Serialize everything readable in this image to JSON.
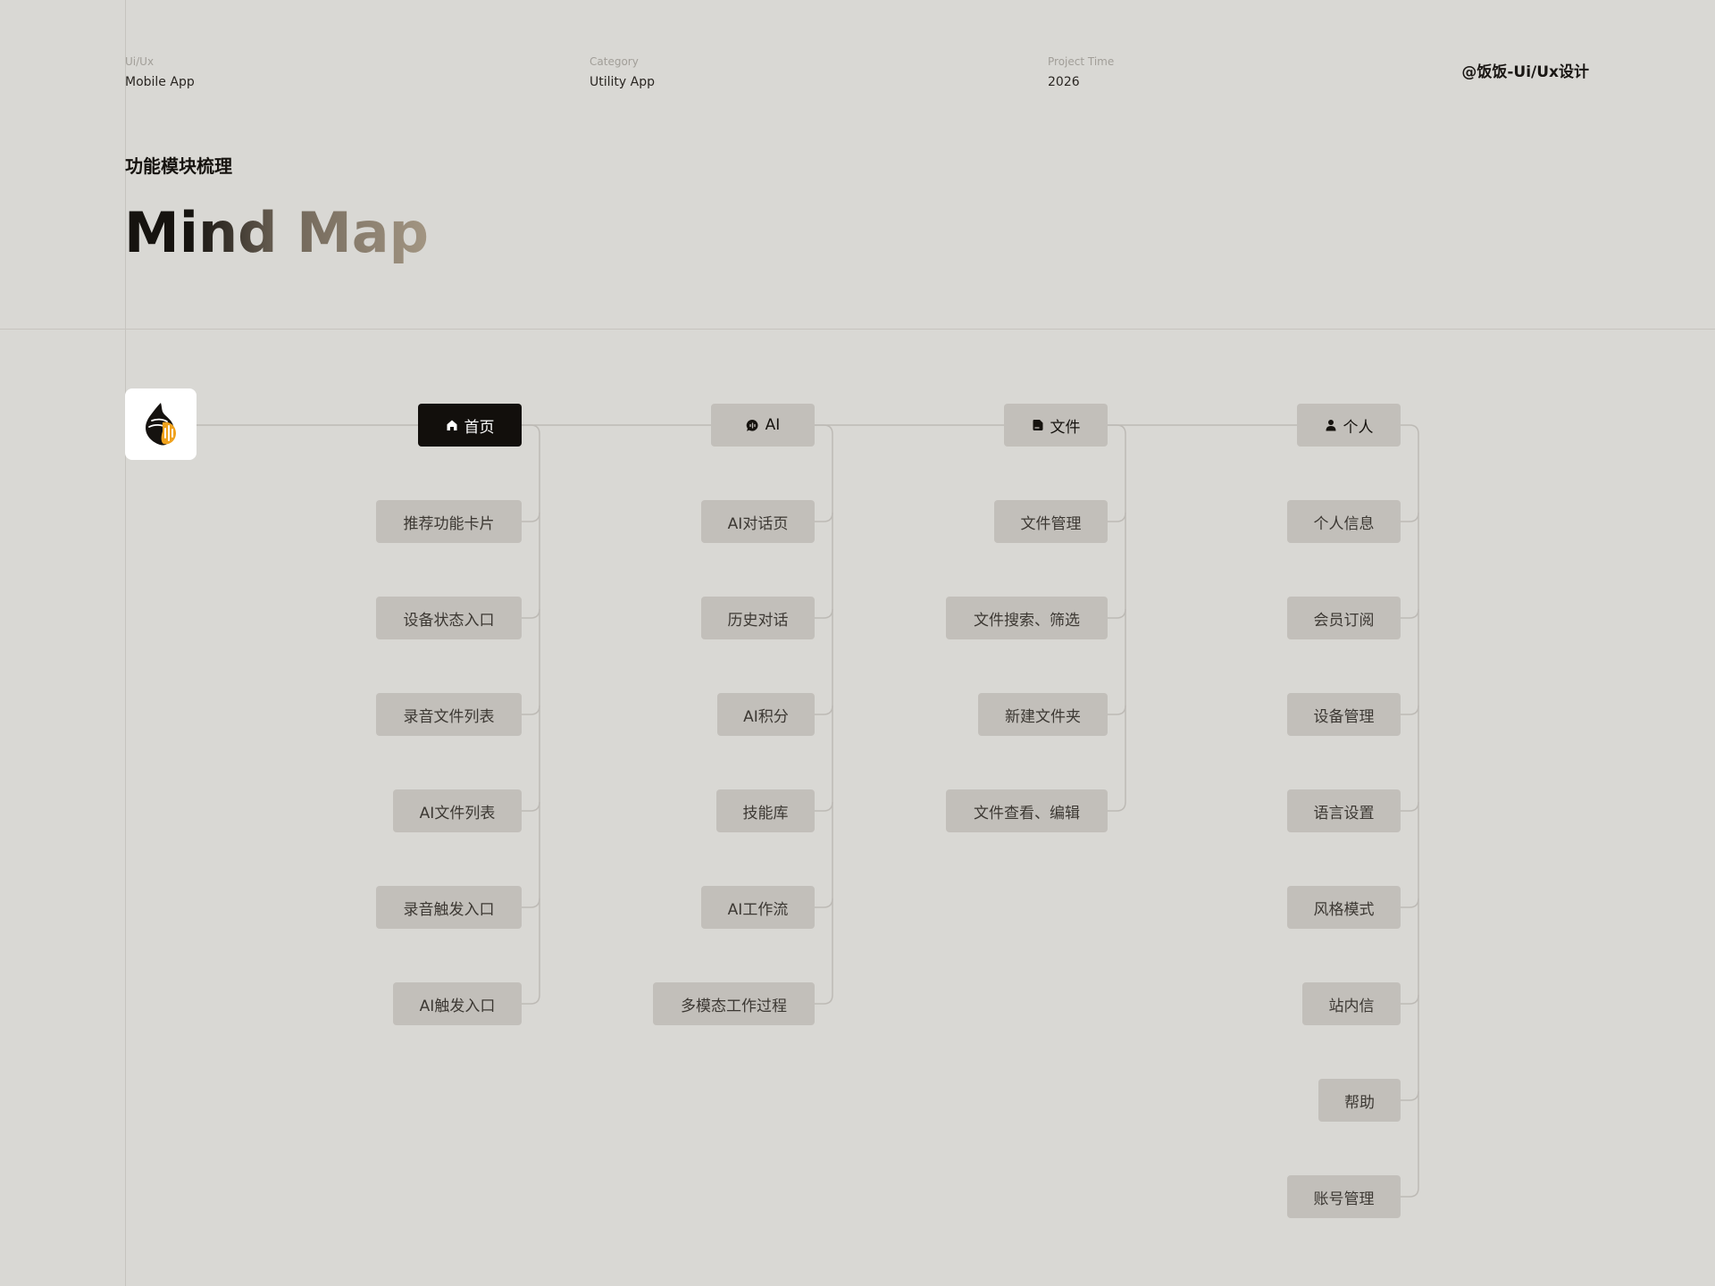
{
  "meta": {
    "col1": {
      "label": "Ui/Ux",
      "value": "Mobile App"
    },
    "col2": {
      "label": "Category",
      "value": "Utility App"
    },
    "col3": {
      "label": "Project Time",
      "value": "2026"
    },
    "author": "@饭饭-Ui/Ux设计"
  },
  "subtitle": "功能模块梳理",
  "title": {
    "part1": "Mind ",
    "part2": "Map"
  },
  "root": {
    "icon": "conch-shell-logo-icon"
  },
  "branches": [
    {
      "label": "首页",
      "icon": "home-icon",
      "active": true,
      "children": [
        "推荐功能卡片",
        "设备状态入口",
        "录音文件列表",
        "AI文件列表",
        "录音触发入口",
        "AI触发入口"
      ]
    },
    {
      "label": "AI",
      "icon": "chat-ai-icon",
      "active": false,
      "children": [
        "AI对话页",
        "历史对话",
        "AI积分",
        "技能库",
        "AI工作流",
        "多模态工作过程"
      ]
    },
    {
      "label": "文件",
      "icon": "file-icon",
      "active": false,
      "children": [
        "文件管理",
        "文件搜索、筛选",
        "新建文件夹",
        "文件查看、编辑"
      ]
    },
    {
      "label": "个人",
      "icon": "user-icon",
      "active": false,
      "children": [
        "个人信息",
        "会员订阅",
        "设备管理",
        "语言设置",
        "风格模式",
        "站内信",
        "帮助",
        "账号管理"
      ]
    }
  ],
  "colors": {
    "background": "#d9d8d4",
    "node_fill": "#c2bfba",
    "active_fill": "#120f0c",
    "connector": "#bdbab5",
    "logo_dark": "#15120f",
    "logo_accent": "#f0a21d"
  }
}
